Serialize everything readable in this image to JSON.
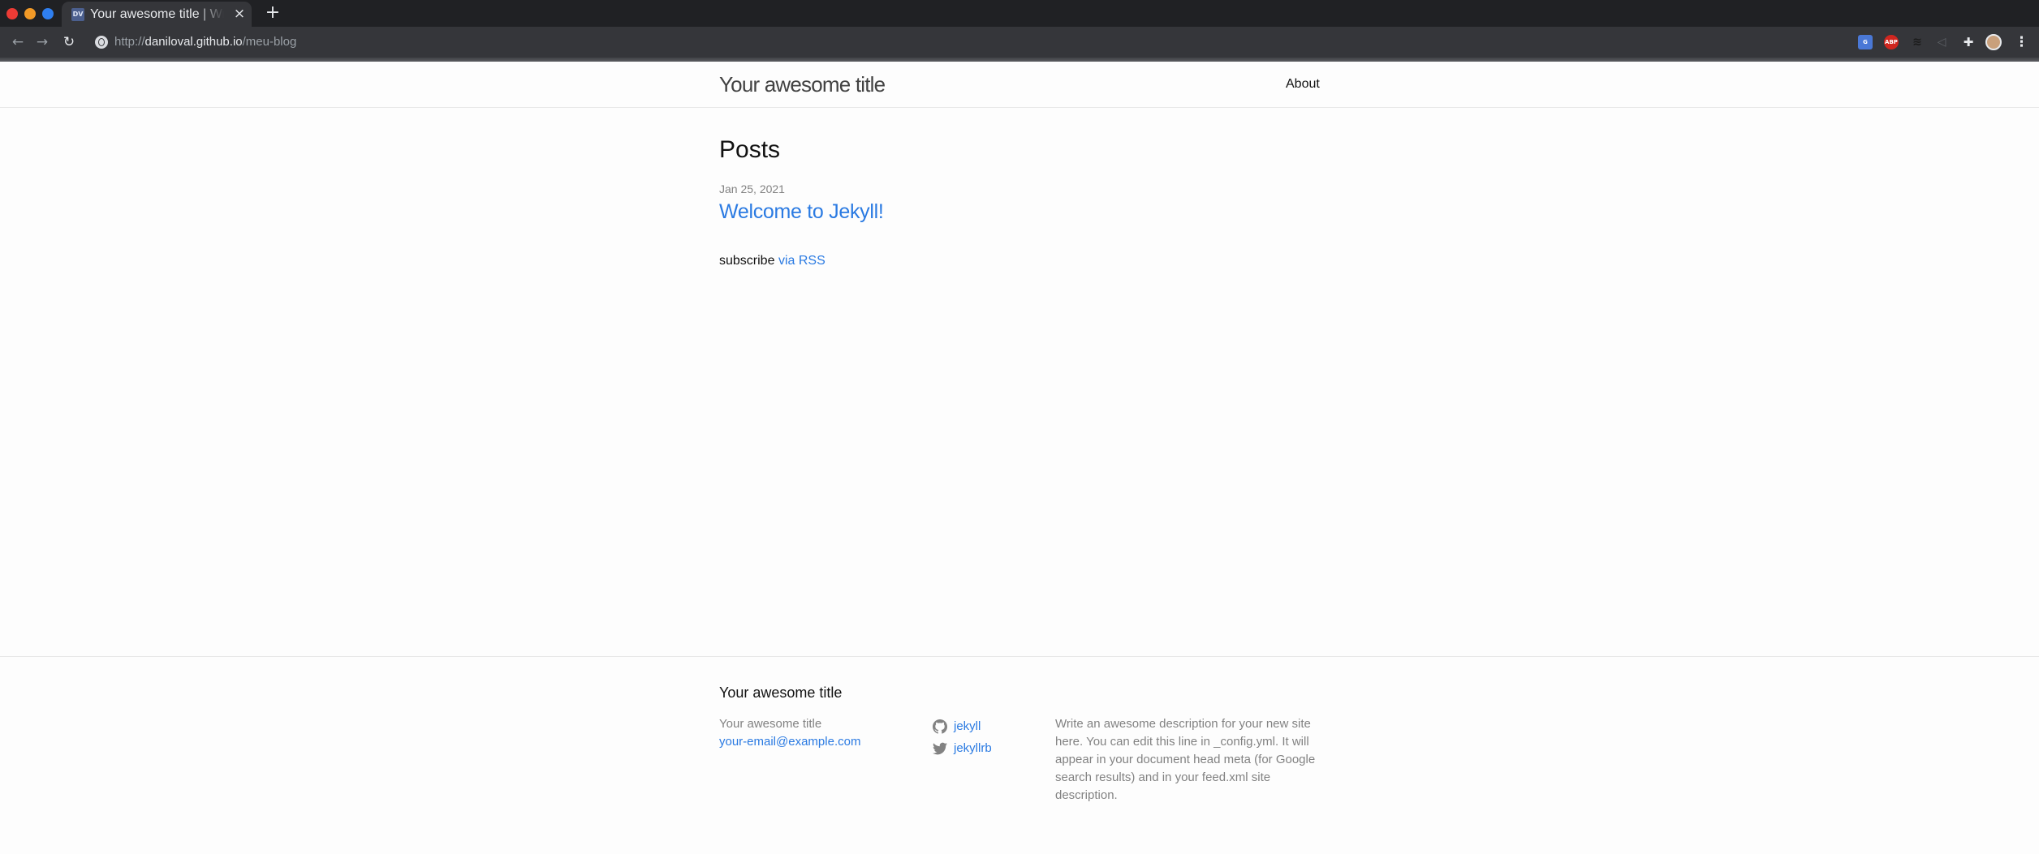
{
  "browser": {
    "tab_title": "Your awesome title | Write an awesome description for your new site here.",
    "tab_favicon": "DV",
    "tab_close": "×",
    "new_tab": "+",
    "url_scheme": "http://",
    "url_host": "daniloval.github.io",
    "url_path": "/meu-blog",
    "icons": [
      "back-arrow-icon",
      "forward-arrow-icon",
      "reload-icon",
      "site-info-icon",
      "translate-extension-icon",
      "adblock-plus-icon",
      "wave-extension-icon",
      "mute-tab-icon",
      "extensions-puzzle-icon",
      "profile-avatar",
      "kebab-menu-icon"
    ],
    "abp_label": "ABP"
  },
  "header": {
    "site_title": "Your awesome title",
    "nav_about": "About"
  },
  "main": {
    "heading": "Posts",
    "posts": [
      {
        "date": "Jan 25, 2021",
        "title": "Welcome to Jekyll!"
      }
    ],
    "subscribe_text": "subscribe",
    "subscribe_link": "via RSS"
  },
  "footer": {
    "heading": "Your awesome title",
    "col1_title": "Your awesome title",
    "email": "your-email@example.com",
    "github_user": "jekyll",
    "twitter_user": "jekyllrb",
    "description": "Write an awesome description for your new site here. You can edit this line in _config.yml. It will appear in your document head meta (for Google search results) and in your feed.xml site description."
  },
  "colors": {
    "link": "#2a7ae2",
    "meta_grey": "#828282",
    "chrome_dark": "#202124",
    "chrome_toolbar": "#35363a"
  }
}
